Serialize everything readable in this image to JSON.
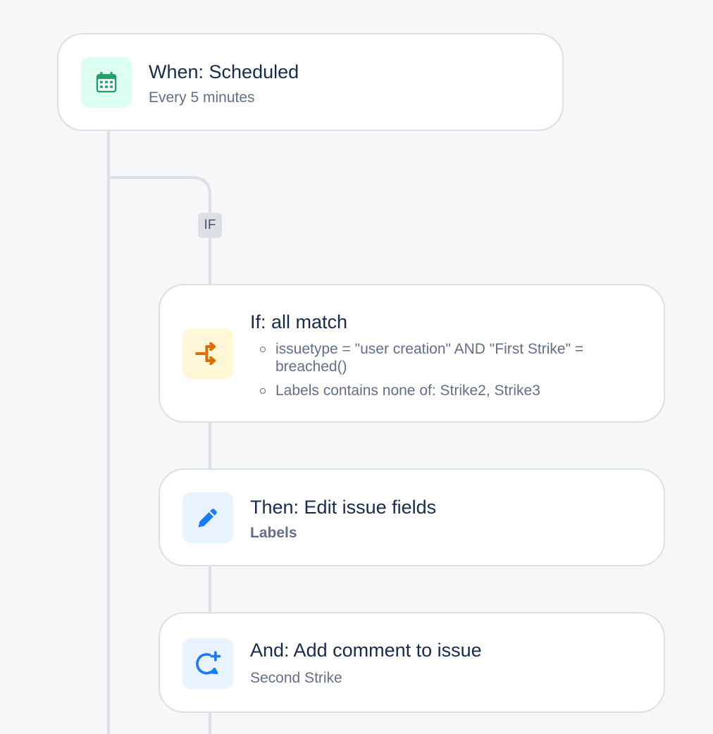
{
  "trigger": {
    "title": "When: Scheduled",
    "subtitle": "Every 5 minutes",
    "icon": "calendar-icon",
    "icon_bg": "#dcfff1",
    "icon_color": "#22a06b"
  },
  "branch_badge": "IF",
  "condition": {
    "title": "If: all match",
    "items": [
      "issuetype = \"user creation\" AND \"First Strike\" = breached()",
      "Labels contains none of: Strike2, Strike3"
    ],
    "icon": "branch-condition-icon",
    "icon_bg": "#fff7d6",
    "icon_color": "#e06c00"
  },
  "action_edit": {
    "title": "Then: Edit issue fields",
    "subtitle": "Labels",
    "icon": "pencil-icon",
    "icon_bg": "#e9f2ff",
    "icon_color": "#1d7afc"
  },
  "action_comment": {
    "title": "And: Add comment to issue",
    "subtitle": "Second Strike",
    "icon": "add-comment-icon",
    "icon_bg": "#e9f2ff",
    "icon_color": "#1d7afc"
  },
  "colors": {
    "background": "#f6f7f9",
    "card_border": "#dcdfe4",
    "connector": "#dcdfe4",
    "title_text": "#172b4d",
    "subtitle_text": "#626f86"
  }
}
